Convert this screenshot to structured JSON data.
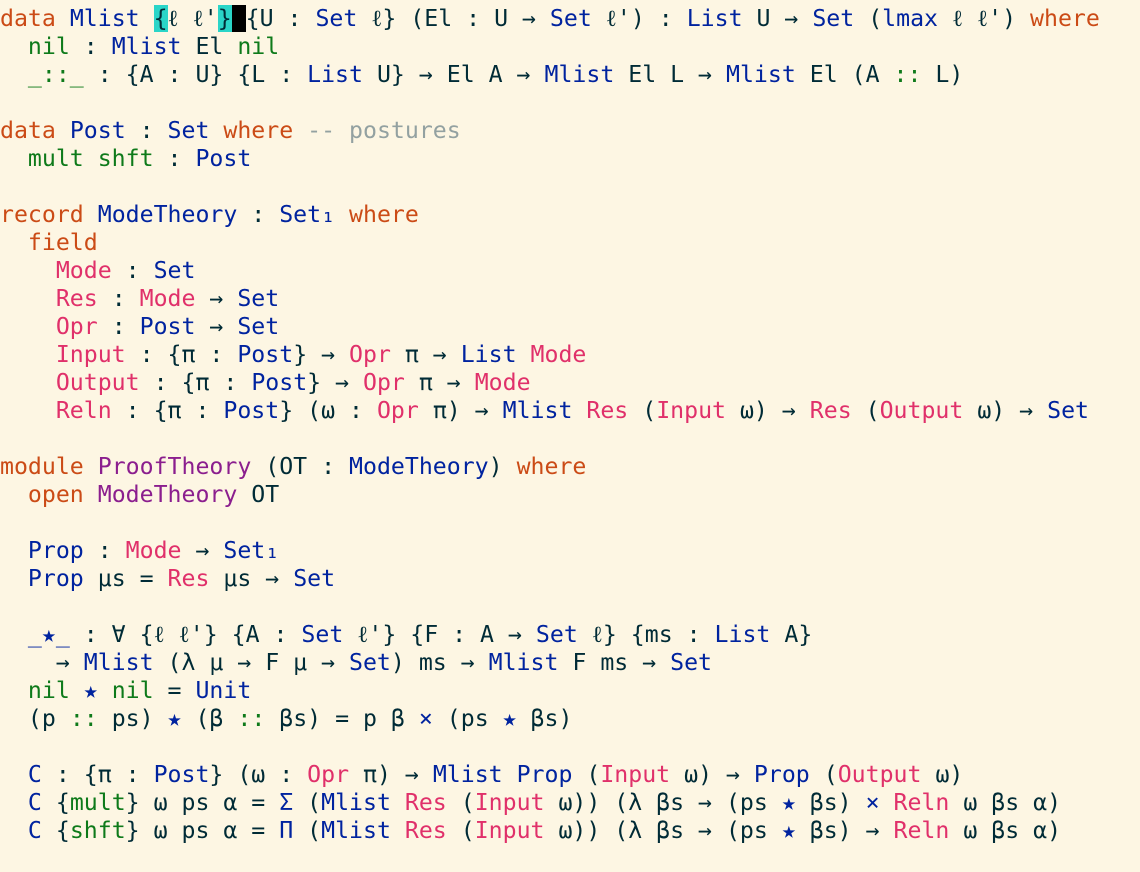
{
  "editor": {
    "lines": [
      [
        [
          "kw",
          "data "
        ],
        [
          "ty",
          "Mlist "
        ],
        [
          "pl+hl",
          "{"
        ],
        [
          "pl",
          "ℓ ℓ'"
        ],
        [
          "pl+hl",
          "}"
        ],
        [
          "cur",
          " "
        ],
        [
          "pl",
          "{U : "
        ],
        [
          "ty",
          "Set "
        ],
        [
          "pl",
          "ℓ} (El : U → "
        ],
        [
          "ty",
          "Set "
        ],
        [
          "pl",
          "ℓ') : "
        ],
        [
          "ty",
          "List "
        ],
        [
          "pl",
          "U → "
        ],
        [
          "ty",
          "Set "
        ],
        [
          "pl",
          "("
        ],
        [
          "ty",
          "lmax "
        ],
        [
          "pl",
          "ℓ ℓ') "
        ],
        [
          "kw",
          "where"
        ]
      ],
      [
        [
          "pl",
          "  "
        ],
        [
          "ctor",
          "nil "
        ],
        [
          "pl",
          ": "
        ],
        [
          "ty",
          "Mlist "
        ],
        [
          "pl",
          "El "
        ],
        [
          "ctor",
          "nil"
        ]
      ],
      [
        [
          "pl",
          "  "
        ],
        [
          "ctor",
          "_::_ "
        ],
        [
          "pl",
          ": {A : U} {L : "
        ],
        [
          "ty",
          "List "
        ],
        [
          "pl",
          "U} → El A → "
        ],
        [
          "ty",
          "Mlist "
        ],
        [
          "pl",
          "El L → "
        ],
        [
          "ty",
          "Mlist "
        ],
        [
          "pl",
          "El (A "
        ],
        [
          "ctor",
          "::"
        ],
        [
          "pl",
          " L)"
        ]
      ],
      [],
      [
        [
          "kw",
          "data "
        ],
        [
          "ty",
          "Post "
        ],
        [
          "pl",
          ": "
        ],
        [
          "ty",
          "Set "
        ],
        [
          "kw",
          "where "
        ],
        [
          "cmt",
          "-- postures"
        ]
      ],
      [
        [
          "pl",
          "  "
        ],
        [
          "ctor",
          "mult shft "
        ],
        [
          "pl",
          ": "
        ],
        [
          "ty",
          "Post"
        ]
      ],
      [],
      [
        [
          "kw",
          "record "
        ],
        [
          "ty",
          "ModeTheory "
        ],
        [
          "pl",
          ": "
        ],
        [
          "ty",
          "Set₁ "
        ],
        [
          "kw",
          "where"
        ]
      ],
      [
        [
          "pl",
          "  "
        ],
        [
          "kw",
          "field"
        ]
      ],
      [
        [
          "pl",
          "    "
        ],
        [
          "fld",
          "Mode "
        ],
        [
          "pl",
          ": "
        ],
        [
          "ty",
          "Set"
        ]
      ],
      [
        [
          "pl",
          "    "
        ],
        [
          "fld",
          "Res "
        ],
        [
          "pl",
          ": "
        ],
        [
          "fld",
          "Mode "
        ],
        [
          "pl",
          "→ "
        ],
        [
          "ty",
          "Set"
        ]
      ],
      [
        [
          "pl",
          "    "
        ],
        [
          "fld",
          "Opr "
        ],
        [
          "pl",
          ": "
        ],
        [
          "ty",
          "Post "
        ],
        [
          "pl",
          "→ "
        ],
        [
          "ty",
          "Set"
        ]
      ],
      [
        [
          "pl",
          "    "
        ],
        [
          "fld",
          "Input "
        ],
        [
          "pl",
          ": {π : "
        ],
        [
          "ty",
          "Post"
        ],
        [
          "pl",
          "} → "
        ],
        [
          "fld",
          "Opr "
        ],
        [
          "pl",
          "π → "
        ],
        [
          "ty",
          "List "
        ],
        [
          "fld",
          "Mode"
        ]
      ],
      [
        [
          "pl",
          "    "
        ],
        [
          "fld",
          "Output "
        ],
        [
          "pl",
          ": {π : "
        ],
        [
          "ty",
          "Post"
        ],
        [
          "pl",
          "} → "
        ],
        [
          "fld",
          "Opr "
        ],
        [
          "pl",
          "π → "
        ],
        [
          "fld",
          "Mode"
        ]
      ],
      [
        [
          "pl",
          "    "
        ],
        [
          "fld",
          "Reln "
        ],
        [
          "pl",
          ": {π : "
        ],
        [
          "ty",
          "Post"
        ],
        [
          "pl",
          "} (ω : "
        ],
        [
          "fld",
          "Opr "
        ],
        [
          "pl",
          "π) → "
        ],
        [
          "ty",
          "Mlist "
        ],
        [
          "fld",
          "Res "
        ],
        [
          "pl",
          "("
        ],
        [
          "fld",
          "Input "
        ],
        [
          "pl",
          "ω) → "
        ],
        [
          "fld",
          "Res "
        ],
        [
          "pl",
          "("
        ],
        [
          "fld",
          "Output "
        ],
        [
          "pl",
          "ω) → "
        ],
        [
          "ty",
          "Set"
        ]
      ],
      [],
      [
        [
          "kw",
          "module "
        ],
        [
          "mod",
          "ProofTheory "
        ],
        [
          "pl",
          "(OT : "
        ],
        [
          "ty",
          "ModeTheory"
        ],
        [
          "pl",
          ") "
        ],
        [
          "kw",
          "where"
        ]
      ],
      [
        [
          "pl",
          "  "
        ],
        [
          "kw",
          "open "
        ],
        [
          "mod",
          "ModeTheory "
        ],
        [
          "pl",
          "OT"
        ]
      ],
      [],
      [
        [
          "pl",
          "  "
        ],
        [
          "ty",
          "Prop "
        ],
        [
          "pl",
          ": "
        ],
        [
          "fld",
          "Mode "
        ],
        [
          "pl",
          "→ "
        ],
        [
          "ty",
          "Set₁"
        ]
      ],
      [
        [
          "pl",
          "  "
        ],
        [
          "ty",
          "Prop "
        ],
        [
          "pl",
          "μs = "
        ],
        [
          "fld",
          "Res "
        ],
        [
          "pl",
          "μs → "
        ],
        [
          "ty",
          "Set"
        ]
      ],
      [],
      [
        [
          "pl",
          "  "
        ],
        [
          "ty",
          "_★_ "
        ],
        [
          "pl",
          ": ∀ {ℓ ℓ'} {A : "
        ],
        [
          "ty",
          "Set "
        ],
        [
          "pl",
          "ℓ'} {F : A → "
        ],
        [
          "ty",
          "Set "
        ],
        [
          "pl",
          "ℓ} {ms : "
        ],
        [
          "ty",
          "List "
        ],
        [
          "pl",
          "A}"
        ]
      ],
      [
        [
          "pl",
          "    → "
        ],
        [
          "ty",
          "Mlist "
        ],
        [
          "pl",
          "(λ μ → F μ → "
        ],
        [
          "ty",
          "Set"
        ],
        [
          "pl",
          ") ms → "
        ],
        [
          "ty",
          "Mlist "
        ],
        [
          "pl",
          "F ms → "
        ],
        [
          "ty",
          "Set"
        ]
      ],
      [
        [
          "pl",
          "  "
        ],
        [
          "ctor",
          "nil "
        ],
        [
          "ty",
          "★ "
        ],
        [
          "ctor",
          "nil "
        ],
        [
          "pl",
          "= "
        ],
        [
          "ty",
          "Unit"
        ]
      ],
      [
        [
          "pl",
          "  (p "
        ],
        [
          "ctor",
          ":: "
        ],
        [
          "pl",
          "ps) "
        ],
        [
          "ty",
          "★ "
        ],
        [
          "pl",
          "(β "
        ],
        [
          "ctor",
          ":: "
        ],
        [
          "pl",
          "βs) = p β "
        ],
        [
          "ty",
          "× "
        ],
        [
          "pl",
          "(ps "
        ],
        [
          "ty",
          "★ "
        ],
        [
          "pl",
          "βs)"
        ]
      ],
      [],
      [
        [
          "pl",
          "  "
        ],
        [
          "ty",
          "C "
        ],
        [
          "pl",
          ": {π : "
        ],
        [
          "ty",
          "Post"
        ],
        [
          "pl",
          "} (ω : "
        ],
        [
          "fld",
          "Opr "
        ],
        [
          "pl",
          "π) → "
        ],
        [
          "ty",
          "Mlist Prop "
        ],
        [
          "pl",
          "("
        ],
        [
          "fld",
          "Input "
        ],
        [
          "pl",
          "ω) → "
        ],
        [
          "ty",
          "Prop "
        ],
        [
          "pl",
          "("
        ],
        [
          "fld",
          "Output "
        ],
        [
          "pl",
          "ω)"
        ]
      ],
      [
        [
          "pl",
          "  "
        ],
        [
          "ty",
          "C "
        ],
        [
          "pl",
          "{"
        ],
        [
          "ctor",
          "mult"
        ],
        [
          "pl",
          "} ω ps α = "
        ],
        [
          "ty",
          "Σ "
        ],
        [
          "pl",
          "("
        ],
        [
          "ty",
          "Mlist "
        ],
        [
          "fld",
          "Res "
        ],
        [
          "pl",
          "("
        ],
        [
          "fld",
          "Input "
        ],
        [
          "pl",
          "ω)) (λ βs → (ps "
        ],
        [
          "ty",
          "★ "
        ],
        [
          "pl",
          "βs) "
        ],
        [
          "ty",
          "× "
        ],
        [
          "fld",
          "Reln "
        ],
        [
          "pl",
          "ω βs α)"
        ]
      ],
      [
        [
          "pl",
          "  "
        ],
        [
          "ty",
          "C "
        ],
        [
          "pl",
          "{"
        ],
        [
          "ctor",
          "shft"
        ],
        [
          "pl",
          "} ω ps α = "
        ],
        [
          "ty",
          "Π "
        ],
        [
          "pl",
          "("
        ],
        [
          "ty",
          "Mlist "
        ],
        [
          "fld",
          "Res "
        ],
        [
          "pl",
          "("
        ],
        [
          "fld",
          "Input "
        ],
        [
          "pl",
          "ω)) (λ βs → (ps "
        ],
        [
          "ty",
          "★ "
        ],
        [
          "pl",
          "βs) → "
        ],
        [
          "fld",
          "Reln "
        ],
        [
          "pl",
          "ω βs α)"
        ]
      ]
    ]
  }
}
